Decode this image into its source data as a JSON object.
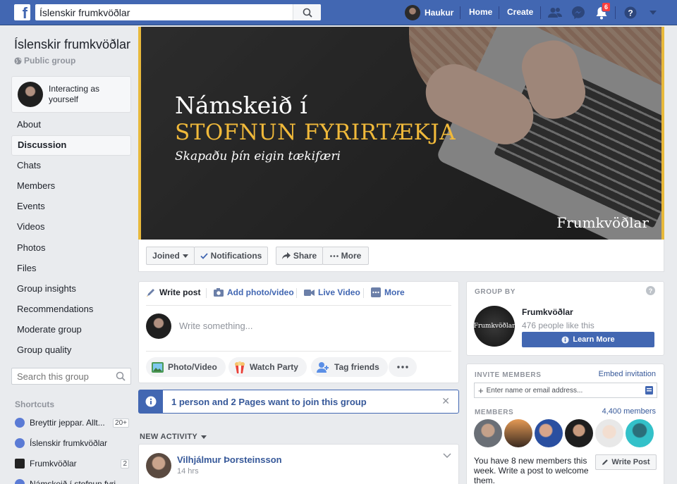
{
  "topbar": {
    "logo": "f",
    "search_value": "Íslenskir frumkvöðlar",
    "user_name": "Haukur",
    "home": "Home",
    "create": "Create",
    "notifications_count": "6",
    "colors": {
      "bar": "#4267b2"
    }
  },
  "group": {
    "name": "Íslenskir frumkvöðlar",
    "privacy": "Public group",
    "interacting": "Interacting as yourself"
  },
  "left_nav": {
    "items": [
      "About",
      "Discussion",
      "Chats",
      "Members",
      "Events",
      "Videos",
      "Photos",
      "Files",
      "Group insights",
      "Recommendations",
      "Moderate group",
      "Group quality"
    ],
    "active": "Discussion",
    "search_placeholder": "Search this group",
    "shortcuts_title": "Shortcuts",
    "shortcuts": [
      {
        "label": "Breyttir jeppar. Allt...",
        "count": "20+"
      },
      {
        "label": "Íslenskir frumkvöðlar",
        "count": ""
      },
      {
        "label": "Frumkvöðlar",
        "count": "2"
      },
      {
        "label": "Námskeið í stofnun fyri",
        "count": ""
      }
    ]
  },
  "cover": {
    "line1": "Námskeið í",
    "line2": "STOFNUN FYRIRTÆKJA",
    "subtitle": "Skapaðu þín eigin tækifæri",
    "brand": "Frumkvöðlar"
  },
  "actions": {
    "joined": "Joined",
    "notifications": "Notifications",
    "share": "Share",
    "more": "More"
  },
  "composer": {
    "tabs": [
      "Write post",
      "Add photo/video",
      "Live Video",
      "More"
    ],
    "placeholder": "Write something...",
    "pills": [
      "Photo/Video",
      "Watch Party",
      "Tag friends"
    ]
  },
  "join_notice": "1 person and 2 Pages want to join this group",
  "feed": {
    "section_title": "NEW ACTIVITY",
    "post_author": "Vilhjálmur Þorsteinsson",
    "post_time": "14 hrs"
  },
  "group_by": {
    "title": "GROUP BY",
    "name": "Frumkvöðlar",
    "likes": "476 people like this",
    "button": "Learn More",
    "logo_text": "Frumkvöðlar"
  },
  "invite": {
    "title": "INVITE MEMBERS",
    "embed_link": "Embed invitation",
    "placeholder": "Enter name or email address...",
    "members_title": "MEMBERS",
    "members_count": "4,400 members",
    "new_members_text": "You have 8 new members this week. Write a post to welcome them.",
    "write_post": "Write Post"
  }
}
